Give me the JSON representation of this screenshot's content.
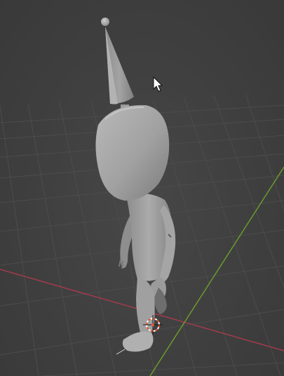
{
  "viewport": {
    "background_color": "#3d3d3d",
    "grid_color": "#4c4c4c",
    "x_axis_color": "#a33a4d",
    "y_axis_color": "#6b9a2c",
    "model_color": "#a7a7a7",
    "cursor_origin_color": "#e8542d"
  },
  "scene_objects": [
    {
      "name": "clown-character",
      "type": "mesh"
    },
    {
      "name": "party-hat",
      "type": "cone"
    }
  ],
  "icons": {
    "cursor": "mouse-pointer-icon",
    "origin": "3d-cursor-icon"
  }
}
